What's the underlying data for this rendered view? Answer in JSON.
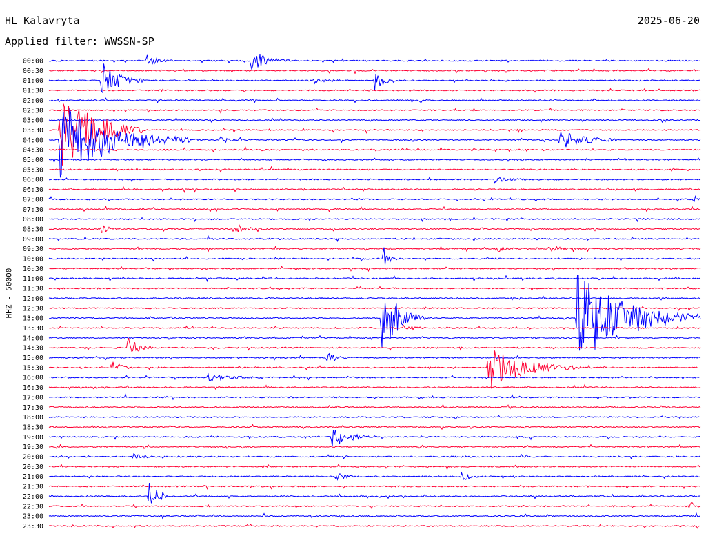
{
  "header": {
    "station": "HL Kalavryta",
    "date": "2025-06-20",
    "filter": "Applied filter: WWSSN-SP",
    "ylabel": "HHZ - 50000"
  },
  "colors": {
    "even": "#0000ff",
    "odd": "#ff0033",
    "background": "#ffffff"
  },
  "chart_data": {
    "type": "line",
    "subtype": "helicorder",
    "x_unit": "minutes",
    "x_range": [
      0,
      30
    ],
    "row_labels": [
      "00:00",
      "00:30",
      "01:00",
      "01:30",
      "02:00",
      "02:30",
      "03:00",
      "03:30",
      "04:00",
      "04:30",
      "05:00",
      "05:30",
      "06:00",
      "06:30",
      "07:00",
      "07:30",
      "08:00",
      "08:30",
      "09:00",
      "09:30",
      "10:00",
      "10:30",
      "11:00",
      "11:30",
      "12:00",
      "12:30",
      "13:00",
      "13:30",
      "14:00",
      "14:30",
      "15:00",
      "15:30",
      "16:00",
      "16:30",
      "17:00",
      "17:30",
      "18:00",
      "18:30",
      "19:00",
      "19:30",
      "20:00",
      "20:30",
      "21:00",
      "21:30",
      "22:00",
      "22:30",
      "23:00",
      "23:30"
    ],
    "events": [
      {
        "row": 0,
        "minute": 4.5,
        "amp": 0.6,
        "dur": 1.2
      },
      {
        "row": 0,
        "minute": 9.3,
        "amp": 1.2,
        "dur": 1.8
      },
      {
        "row": 2,
        "minute": 2.4,
        "amp": 2.0,
        "dur": 2.0
      },
      {
        "row": 2,
        "minute": 12.2,
        "amp": 0.4,
        "dur": 1.2
      },
      {
        "row": 2,
        "minute": 15.0,
        "amp": 1.1,
        "dur": 1.2
      },
      {
        "row": 7,
        "minute": 0.5,
        "amp": 4.5,
        "dur": 4.0
      },
      {
        "row": 8,
        "minute": 0.5,
        "amp": 4.0,
        "dur": 6.0
      },
      {
        "row": 8,
        "minute": 7.9,
        "amp": 0.3,
        "dur": 1.5
      },
      {
        "row": 8,
        "minute": 23.5,
        "amp": 1.0,
        "dur": 3.0
      },
      {
        "row": 12,
        "minute": 20.5,
        "amp": 0.4,
        "dur": 1.5
      },
      {
        "row": 14,
        "minute": 29.7,
        "amp": 0.5,
        "dur": 0.5
      },
      {
        "row": 17,
        "minute": 2.4,
        "amp": 0.6,
        "dur": 1.0
      },
      {
        "row": 17,
        "minute": 8.6,
        "amp": 0.4,
        "dur": 1.5
      },
      {
        "row": 19,
        "minute": 20.6,
        "amp": 0.4,
        "dur": 1.0
      },
      {
        "row": 19,
        "minute": 23.0,
        "amp": 0.4,
        "dur": 1.5
      },
      {
        "row": 20,
        "minute": 15.4,
        "amp": 1.5,
        "dur": 0.6
      },
      {
        "row": 26,
        "minute": 15.3,
        "amp": 4.0,
        "dur": 2.0
      },
      {
        "row": 26,
        "minute": 24.3,
        "amp": 5.0,
        "dur": 6.0
      },
      {
        "row": 27,
        "minute": 16.3,
        "amp": 0.5,
        "dur": 1.0
      },
      {
        "row": 29,
        "minute": 3.6,
        "amp": 1.3,
        "dur": 1.2
      },
      {
        "row": 30,
        "minute": 12.8,
        "amp": 0.6,
        "dur": 1.2
      },
      {
        "row": 31,
        "minute": 2.9,
        "amp": 0.8,
        "dur": 1.0
      },
      {
        "row": 31,
        "minute": 20.2,
        "amp": 2.6,
        "dur": 4.0
      },
      {
        "row": 32,
        "minute": 7.3,
        "amp": 0.4,
        "dur": 2.5
      },
      {
        "row": 38,
        "minute": 13.0,
        "amp": 1.0,
        "dur": 2.0
      },
      {
        "row": 40,
        "minute": 3.9,
        "amp": 0.3,
        "dur": 1.5
      },
      {
        "row": 42,
        "minute": 13.2,
        "amp": 0.5,
        "dur": 1.0
      },
      {
        "row": 42,
        "minute": 19.0,
        "amp": 0.6,
        "dur": 0.8
      },
      {
        "row": 44,
        "minute": 4.6,
        "amp": 1.5,
        "dur": 1.0
      },
      {
        "row": 45,
        "minute": 29.5,
        "amp": 0.5,
        "dur": 0.6
      }
    ]
  }
}
